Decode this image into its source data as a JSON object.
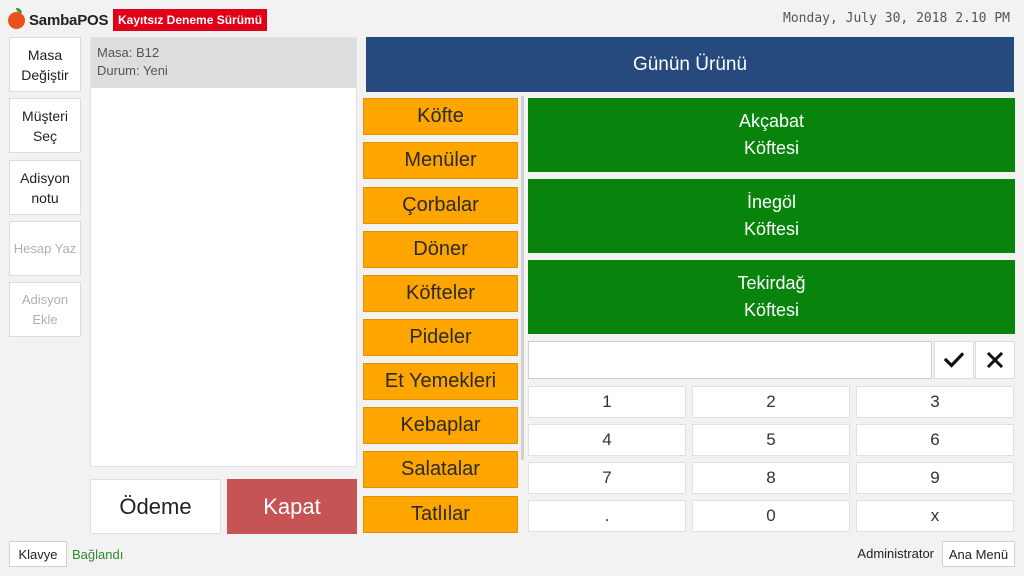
{
  "header": {
    "app_name": "SambaPOS",
    "trial_badge": "Kayıtsız Deneme Sürümü",
    "datetime": "Monday, July 30, 2018 2.10 PM"
  },
  "actions": [
    {
      "label": "Masa\nDeğiştir",
      "enabled": true
    },
    {
      "label": "Müşteri\nSeç",
      "enabled": true
    },
    {
      "label": "Adisyon\nnotu",
      "enabled": true
    },
    {
      "label": "Hesap Yaz",
      "enabled": false
    },
    {
      "label": "Adisyon\nEkle",
      "enabled": false
    }
  ],
  "ticket": {
    "table": "Masa: B12",
    "status": "Durum: Yeni"
  },
  "buttons": {
    "pay": "Ödeme",
    "close": "Kapat"
  },
  "menu": {
    "header": "Günün Ürünü",
    "categories": [
      "Köfte",
      "Menüler",
      "Çorbalar",
      "Döner",
      "Köfteler",
      "Pideler",
      "Et Yemekleri",
      "Kebaplar",
      "Salatalar",
      "Tatlılar"
    ],
    "products": [
      "Akçabat\nKöftesi",
      "İnegöl\nKöftesi",
      "Tekirdağ\nKöftesi"
    ]
  },
  "numpad": {
    "input_value": "",
    "ok_icon": "checkmark-icon",
    "clear_icon": "close-icon",
    "keys": [
      "1",
      "2",
      "3",
      "4",
      "5",
      "6",
      "7",
      "8",
      "9",
      ".",
      "0",
      "x"
    ]
  },
  "footer": {
    "keyboard": "Klavye",
    "connection": "Bağlandı",
    "user": "Administrator",
    "main_menu": "Ana Menü"
  },
  "colors": {
    "trial_red": "#e0001a",
    "header_blue": "#264a7e",
    "category_orange": "#ffa500",
    "product_green": "#08840c",
    "close_red": "#c65454",
    "connected_green": "#2e8b2e"
  }
}
